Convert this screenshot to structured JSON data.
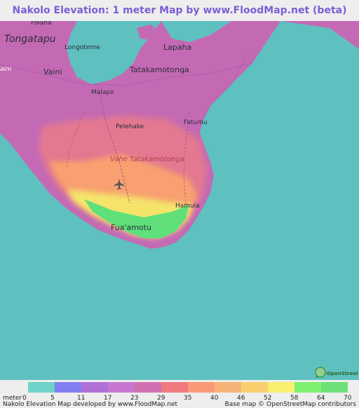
{
  "title": "Nakolo Elevation: 1 meter Map by www.FloodMap.net (beta)",
  "colors": {
    "sea": "#5fc0c0",
    "title": "#7b5fd4"
  },
  "places": [
    {
      "id": "folaha",
      "name": "Folaha"
    },
    {
      "id": "tongatapu",
      "name": "Tongatapu"
    },
    {
      "id": "longoteme",
      "name": "Longoteme"
    },
    {
      "id": "lapaha",
      "name": "Lapaha"
    },
    {
      "id": "vaini",
      "name": "Vaini"
    },
    {
      "id": "vaini-left",
      "name": "aini"
    },
    {
      "id": "tatakamotonga",
      "name": "Tatakamotonga"
    },
    {
      "id": "malapo",
      "name": "Malapo"
    },
    {
      "id": "fatumu",
      "name": "Fatumu"
    },
    {
      "id": "pelehake",
      "name": "Pelehake"
    },
    {
      "id": "vahe",
      "name": "Vahe Tatakamotonga"
    },
    {
      "id": "hamula",
      "name": "Hamula"
    },
    {
      "id": "fuaamotu",
      "name": "Fua'amotu"
    }
  ],
  "osm_badge": "OpenStreetMap",
  "legend": {
    "unit_label": "meter",
    "ticks": [
      "0",
      "5",
      "11",
      "17",
      "23",
      "29",
      "35",
      "40",
      "46",
      "52",
      "58",
      "64",
      "70"
    ],
    "colors": [
      "#6fd3c9",
      "#7f7ff0",
      "#b070d8",
      "#c877d0",
      "#d070b0",
      "#f07a80",
      "#f89a78",
      "#f8b478",
      "#f8d070",
      "#f8f070",
      "#80f070",
      "#6ee07a"
    ]
  },
  "credits": {
    "left": "Nakolo Elevation Map developed by www.FloodMap.net",
    "right": "Base map © OpenStreetMap contributors"
  }
}
